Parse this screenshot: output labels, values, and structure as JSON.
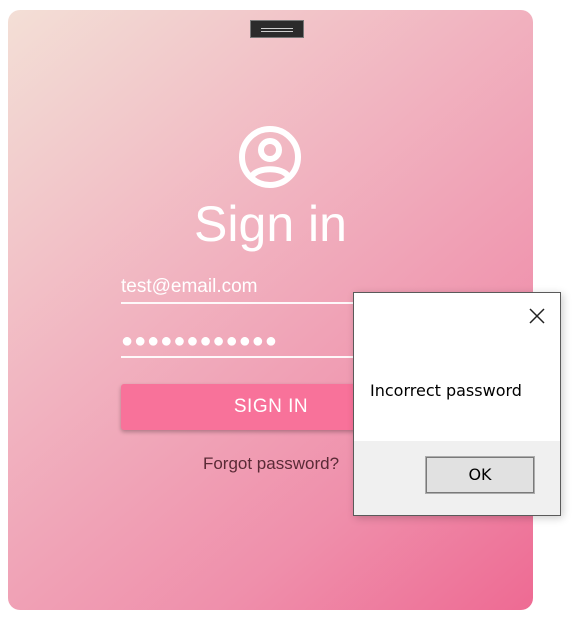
{
  "login": {
    "title": "Sign in",
    "email_value": "test@email.com",
    "password_masked": "●●●●●●●●●●●●",
    "signin_label": "SIGN IN",
    "forgot_label": "Forgot password?"
  },
  "dialog": {
    "message": "Incorrect password",
    "ok_label": "OK"
  },
  "icons": {
    "user": "user-circle-icon",
    "close": "close-icon",
    "drag": "drag-handle-icon"
  },
  "colors": {
    "gradient_start": "#f3dfd6",
    "gradient_end": "#ee6a93",
    "button": "#f8729a",
    "dialog_footer": "#f0f0f0"
  }
}
